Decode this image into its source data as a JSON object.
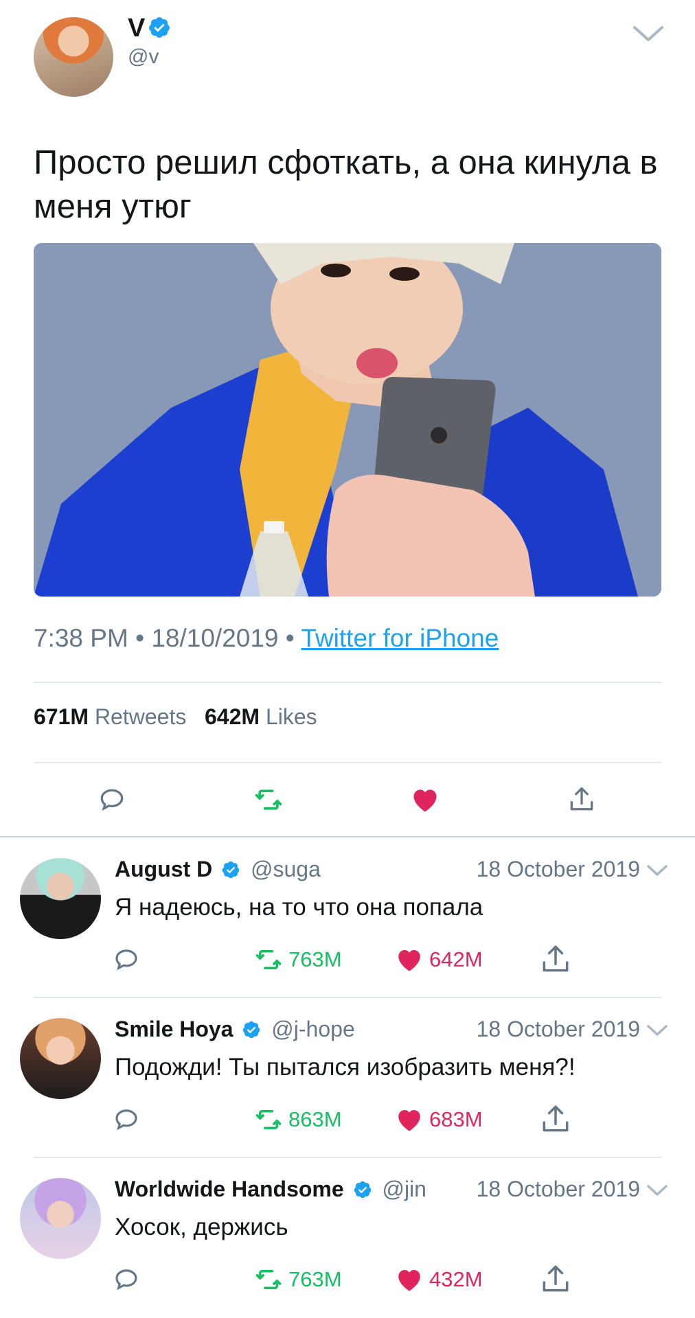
{
  "main_tweet": {
    "author_name": "V",
    "author_handle": "@v",
    "text": "Просто решил сфоткать, а она кинула в меня утюг",
    "time": "7:38 PM",
    "date": "18/10/2019",
    "separator": "•",
    "source": "Twitter for iPhone",
    "retweets_count": "671M",
    "retweets_label": "Retweets",
    "likes_count": "642M",
    "likes_label": "Likes",
    "icons": [
      "reply-icon",
      "retweet-icon",
      "like-icon-filled",
      "share-icon"
    ]
  },
  "replies": [
    {
      "name": "August D",
      "handle": "@suga",
      "date": "18 October 2019",
      "text": "Я надеюсь, на то что она попала",
      "retweets": "763M",
      "likes": "642M"
    },
    {
      "name": "Smile Hoya",
      "handle": "@j-hope",
      "date": "18 October 2019",
      "text": "Подожди! Ты пытался изобразить меня?!",
      "retweets": "863M",
      "likes": "683M"
    },
    {
      "name": "Worldwide Handsome",
      "handle": "@jin",
      "date": "18 October 2019",
      "text": "Хосок, держись",
      "retweets": "763M",
      "likes": "432M"
    }
  ],
  "colors": {
    "text": "#14171a",
    "secondary": "#657786",
    "link": "#1da1f2",
    "retweet": "#17bf63",
    "like": "#e0245e",
    "divider": "#e1e8ed"
  }
}
